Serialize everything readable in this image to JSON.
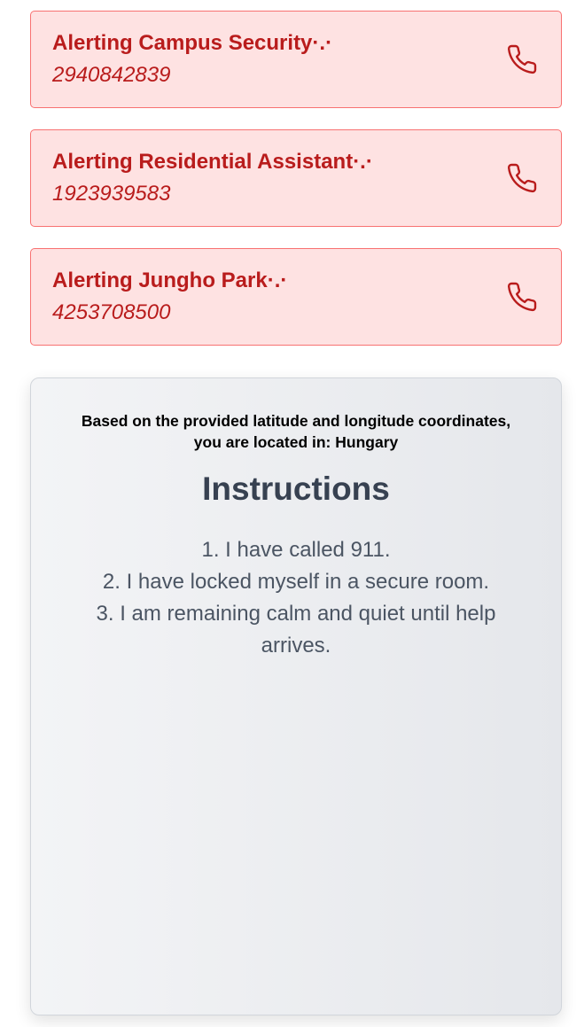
{
  "alerts": [
    {
      "title": "Alerting Campus Security·.·",
      "phone": "2940842839",
      "icon": "phone-icon"
    },
    {
      "title": "Alerting Residential Assistant·.·",
      "phone": "1923939583",
      "icon": "phone-icon"
    },
    {
      "title": "Alerting Jungho Park·.·",
      "phone": "4253708500",
      "icon": "phone-icon"
    }
  ],
  "location": {
    "line1": "Based on the provided latitude and longitude coordinates,",
    "line2": "you are located in: Hungary"
  },
  "instructions": {
    "title": "Instructions",
    "steps": [
      "1. I have called 911.",
      "2. I have locked myself in a secure room.",
      "3. I am remaining calm and quiet until help arrives."
    ]
  },
  "colors": {
    "alert_bg": "#fee2e2",
    "alert_border": "#f87171",
    "alert_text": "#b91c1c",
    "panel_title": "#374151",
    "panel_text": "#4b5563"
  }
}
